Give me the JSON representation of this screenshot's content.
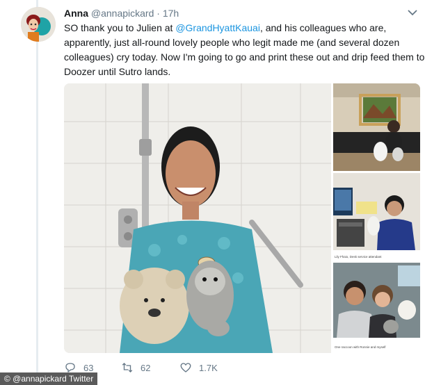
{
  "tweet": {
    "author_name": "Anna",
    "author_handle": "@annapickard",
    "separator": "·",
    "time": "17h",
    "text_parts": [
      "SO thank you to Julien at ",
      "@GrandHyattKauai",
      ", and his colleagues who are, apparently, just all-round lovely people who legit made me (and several dozen colleagues) cry today. Now I'm going to go and print these out and drip feed them to Doozer until Sutro lands."
    ],
    "mention_color": "#1b95e0"
  },
  "media": {
    "caption_small_1": "Lily Fhaio, Desk service attendant",
    "caption_small_2": "One raccoon with Ronnie and myself"
  },
  "actions": {
    "reply_count": "63",
    "retweet_count": "62",
    "like_count": "1.7K"
  },
  "icons": {
    "reply": "reply-icon",
    "retweet": "retweet-icon",
    "like": "heart-icon",
    "more": "chevron-down-icon"
  },
  "credit": "© @annapickard Twitter"
}
